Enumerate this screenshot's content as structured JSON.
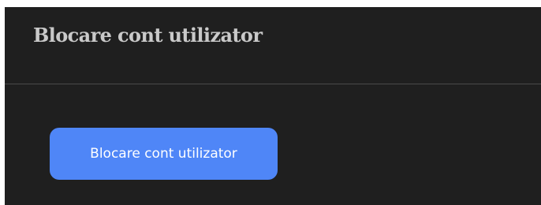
{
  "panel": {
    "title": "Blocare cont utilizator",
    "button_label": "Blocare cont utilizator"
  },
  "colors": {
    "panel_background": "#1f1f1f",
    "title_text": "#c9c9c9",
    "divider": "#4a4a4a",
    "button_accent": "#4f86f7",
    "button_text": "#ffffff"
  }
}
